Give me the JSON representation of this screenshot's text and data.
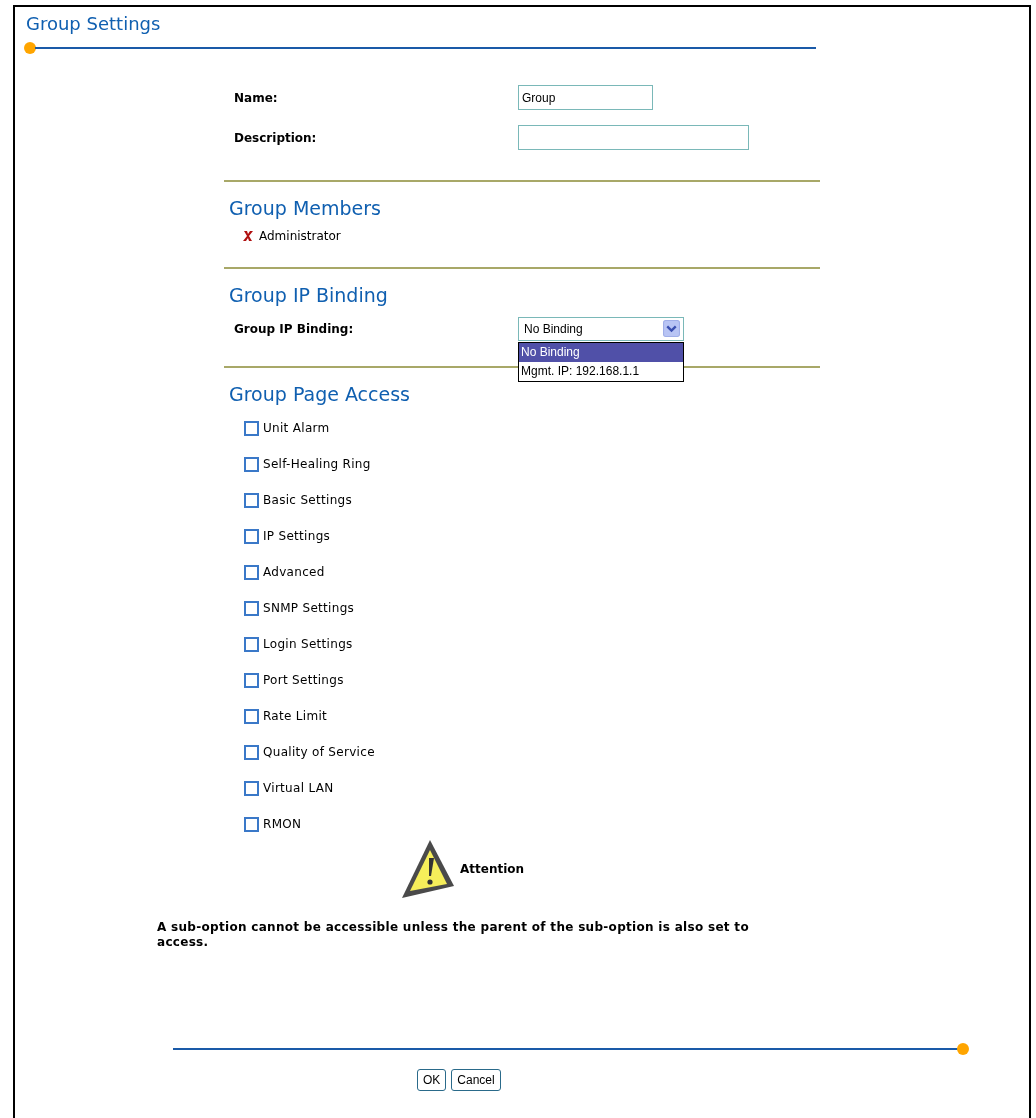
{
  "title": "Group Settings",
  "fields": [
    {
      "label": "Name:",
      "value": "Group"
    },
    {
      "label": "Description:"
    }
  ],
  "members": {
    "heading": "Group Members",
    "items": [
      {
        "name": "Administrator"
      }
    ]
  },
  "ip_binding": {
    "heading": "Group IP Binding",
    "label": "Group IP Binding:",
    "value": "No Binding",
    "expanded": true,
    "options": [
      {
        "label": "No Binding",
        "selected": true
      },
      {
        "label": "Mgmt. IP: 192.168.1.1",
        "selected": false
      }
    ]
  },
  "page_access": {
    "heading": "Group Page Access",
    "items": [
      {
        "label": "Unit Alarm",
        "checked": false
      },
      {
        "label": "Self-Healing Ring",
        "checked": false
      },
      {
        "label": "Basic Settings",
        "checked": false
      },
      {
        "label": "IP Settings",
        "checked": false
      },
      {
        "label": "Advanced",
        "checked": false
      },
      {
        "label": "SNMP Settings",
        "checked": false
      },
      {
        "label": "Login Settings",
        "checked": false
      },
      {
        "label": "Port Settings",
        "checked": false
      },
      {
        "label": "Rate Limit",
        "checked": false
      },
      {
        "label": "Quality of Service",
        "checked": false
      },
      {
        "label": "Virtual LAN",
        "checked": false
      },
      {
        "label": "RMON",
        "checked": false
      }
    ]
  },
  "attention": {
    "title": "Attention",
    "message": "A sub-option cannot be accessible unless the parent of the sub-option is also set to access."
  },
  "buttons": [
    "OK",
    "Cancel"
  ]
}
